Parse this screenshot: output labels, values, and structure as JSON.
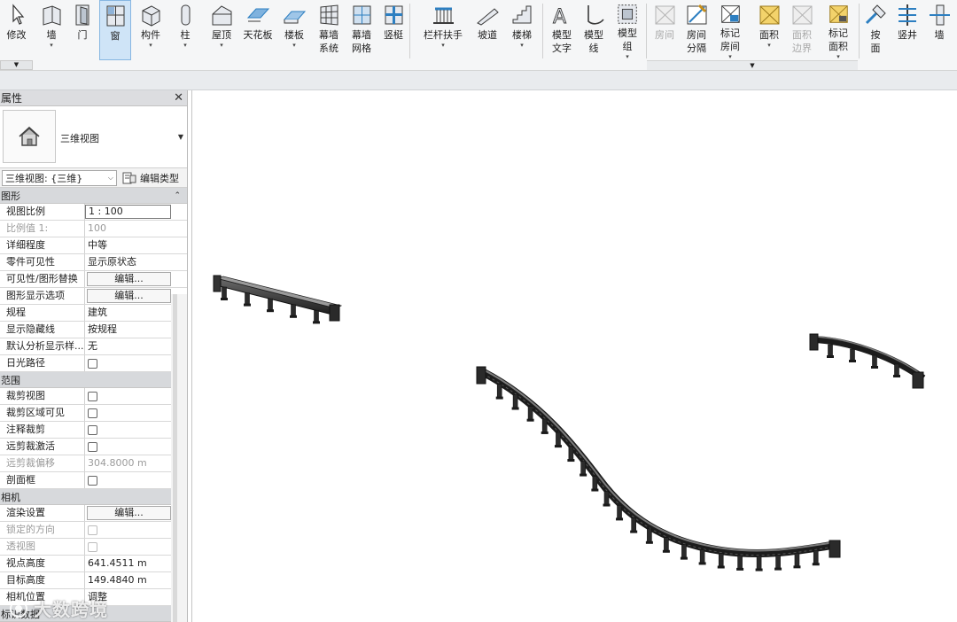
{
  "ribbon": {
    "modify": "修改",
    "buttons": [
      {
        "key": "wall",
        "label": "墙",
        "icon": "wall-icon",
        "arrow": true
      },
      {
        "key": "door",
        "label": "门",
        "icon": "door-icon",
        "arrow": false
      },
      {
        "key": "window",
        "label": "窗",
        "icon": "window-icon",
        "arrow": false,
        "active": true
      },
      {
        "key": "component",
        "label": "构件",
        "icon": "component-icon",
        "arrow": true
      },
      {
        "key": "column",
        "label": "柱",
        "icon": "column-icon",
        "arrow": true
      },
      {
        "key": "roof",
        "label": "屋顶",
        "icon": "roof-icon",
        "arrow": true
      },
      {
        "key": "ceiling",
        "label": "天花板",
        "icon": "ceiling-icon",
        "arrow": false
      },
      {
        "key": "floor",
        "label": "楼板",
        "icon": "floor-icon",
        "arrow": true
      },
      {
        "key": "curtain-system",
        "label": "幕墙\n系统",
        "icon": "curtain-system-icon",
        "arrow": false
      },
      {
        "key": "curtain-grid",
        "label": "幕墙\n网格",
        "icon": "curtain-grid-icon",
        "arrow": false
      },
      {
        "key": "mullion",
        "label": "竖梃",
        "icon": "mullion-icon",
        "arrow": false
      },
      {
        "key": "railing",
        "label": "栏杆扶手",
        "icon": "railing-icon",
        "arrow": true
      },
      {
        "key": "ramp",
        "label": "坡道",
        "icon": "ramp-icon",
        "arrow": false
      },
      {
        "key": "stair",
        "label": "楼梯",
        "icon": "stair-icon",
        "arrow": true
      },
      {
        "key": "model-text",
        "label": "模型\n文字",
        "icon": "model-text-icon",
        "arrow": false
      },
      {
        "key": "model-line",
        "label": "模型\n线",
        "icon": "model-line-icon",
        "arrow": false
      },
      {
        "key": "model-group",
        "label": "模型\n组",
        "icon": "model-group-icon",
        "arrow": true
      },
      {
        "key": "room",
        "label": "房间",
        "icon": "room-icon",
        "arrow": false,
        "disabled": true
      },
      {
        "key": "room-separator",
        "label": "房间\n分隔",
        "icon": "room-separator-icon",
        "arrow": false
      },
      {
        "key": "tag-room",
        "label": "标记\n房间",
        "icon": "tag-room-icon",
        "arrow": true
      },
      {
        "key": "area",
        "label": "面积",
        "icon": "area-icon",
        "arrow": true
      },
      {
        "key": "area-boundary",
        "label": "面积\n边界",
        "icon": "area-boundary-icon",
        "arrow": false,
        "disabled": true
      },
      {
        "key": "tag-area",
        "label": "标记\n面积",
        "icon": "tag-area-icon",
        "arrow": true
      },
      {
        "key": "by-face",
        "label": "按\n面",
        "icon": "by-face-icon",
        "arrow": false
      },
      {
        "key": "shaft",
        "label": "竖井",
        "icon": "shaft-icon",
        "arrow": false
      },
      {
        "key": "opening-wall",
        "label": "墙",
        "icon": "opening-wall-icon",
        "arrow": false
      }
    ]
  },
  "properties": {
    "title": "属性",
    "type_name": "三维视图",
    "selector_value": "三维视图: {三维}",
    "edit_type": "编辑类型",
    "sections": [
      {
        "title": "图形",
        "rows": [
          {
            "name": "视图比例",
            "value": "1 : 100",
            "kind": "boxed"
          },
          {
            "name": "比例值 1:",
            "value": "100",
            "kind": "text",
            "disabled": true
          },
          {
            "name": "详细程度",
            "value": "中等",
            "kind": "text"
          },
          {
            "name": "零件可见性",
            "value": "显示原状态",
            "kind": "text"
          },
          {
            "name": "可见性/图形替换",
            "value": "编辑...",
            "kind": "button"
          },
          {
            "name": "图形显示选项",
            "value": "编辑...",
            "kind": "button"
          },
          {
            "name": "规程",
            "value": "建筑",
            "kind": "text"
          },
          {
            "name": "显示隐藏线",
            "value": "按规程",
            "kind": "text"
          },
          {
            "name": "默认分析显示样...",
            "value": "无",
            "kind": "text"
          },
          {
            "name": "日光路径",
            "value": "",
            "kind": "check"
          }
        ]
      },
      {
        "title": "范围",
        "rows": [
          {
            "name": "裁剪视图",
            "value": "",
            "kind": "check"
          },
          {
            "name": "裁剪区域可见",
            "value": "",
            "kind": "check"
          },
          {
            "name": "注释裁剪",
            "value": "",
            "kind": "check"
          },
          {
            "name": "远剪裁激活",
            "value": "",
            "kind": "check"
          },
          {
            "name": "远剪裁偏移",
            "value": "304.8000 m",
            "kind": "text",
            "disabled": true
          },
          {
            "name": "剖面框",
            "value": "",
            "kind": "check"
          }
        ]
      },
      {
        "title": "相机",
        "rows": [
          {
            "name": "渲染设置",
            "value": "编辑...",
            "kind": "button"
          },
          {
            "name": "锁定的方向",
            "value": "",
            "kind": "check",
            "disabled": true
          },
          {
            "name": "透视图",
            "value": "",
            "kind": "check",
            "disabled": true
          },
          {
            "name": "视点高度",
            "value": "641.4511 m",
            "kind": "text"
          },
          {
            "name": "目标高度",
            "value": "149.4840 m",
            "kind": "text"
          },
          {
            "name": "相机位置",
            "value": "调整",
            "kind": "text"
          }
        ]
      },
      {
        "title": "标识数据",
        "rows": []
      }
    ]
  },
  "watermark": "大数跨境",
  "colors": {
    "ribbon_bg": "#f5f6f7",
    "active_bg": "#cfe4f7",
    "panel_bg": "#f3f3f3",
    "section_bg": "#d7d9dc",
    "model": "#2b2b2b"
  }
}
